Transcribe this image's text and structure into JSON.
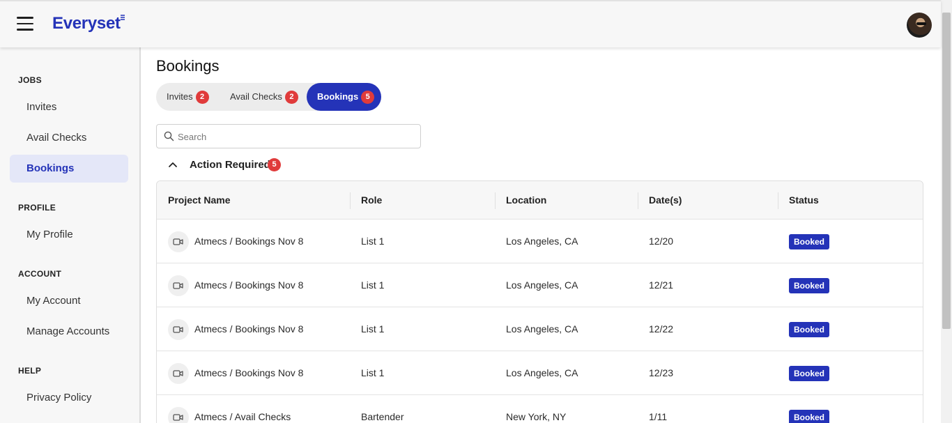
{
  "brand": {
    "name": "Everyset",
    "color": "#2433b8"
  },
  "header": {
    "menu_icon": "hamburger-icon",
    "avatar_icon": "user-avatar"
  },
  "sidebar": {
    "sections": [
      {
        "title": "JOBS",
        "items": [
          "Invites",
          "Avail Checks",
          "Bookings"
        ]
      },
      {
        "title": "PROFILE",
        "items": [
          "My Profile"
        ]
      },
      {
        "title": "ACCOUNT",
        "items": [
          "My Account",
          "Manage Accounts"
        ]
      },
      {
        "title": "HELP",
        "items": [
          "Privacy Policy"
        ]
      }
    ],
    "active_item": "Bookings"
  },
  "page": {
    "title": "Bookings"
  },
  "tabs": [
    {
      "label": "Invites",
      "count": "2"
    },
    {
      "label": "Avail Checks",
      "count": "2"
    },
    {
      "label": "Bookings",
      "count": "5"
    }
  ],
  "active_tab": "Bookings",
  "search": {
    "placeholder": "Search",
    "value": ""
  },
  "section": {
    "label": "Action Required",
    "count": "5",
    "icon": "chevron-up-icon"
  },
  "table": {
    "columns": [
      "Project Name",
      "Role",
      "Location",
      "Date(s)",
      "Status"
    ],
    "rows": [
      {
        "project": "Atmecs / Bookings Nov 8",
        "role": "List 1",
        "location": "Los Angeles, CA",
        "dates": "12/20",
        "status": "Booked"
      },
      {
        "project": "Atmecs / Bookings Nov 8",
        "role": "List 1",
        "location": "Los Angeles, CA",
        "dates": "12/21",
        "status": "Booked"
      },
      {
        "project": "Atmecs / Bookings Nov 8",
        "role": "List 1",
        "location": "Los Angeles, CA",
        "dates": "12/22",
        "status": "Booked"
      },
      {
        "project": "Atmecs / Bookings Nov 8",
        "role": "List 1",
        "location": "Los Angeles, CA",
        "dates": "12/23",
        "status": "Booked"
      },
      {
        "project": "Atmecs / Avail Checks",
        "role": "Bartender",
        "location": "New York, NY",
        "dates": "1/11",
        "status": "Booked"
      }
    ],
    "row_icon": "video-camera-icon"
  },
  "colors": {
    "accent": "#2433b8",
    "badge": "#e03b3b",
    "active_bg": "#e4e7f8"
  }
}
